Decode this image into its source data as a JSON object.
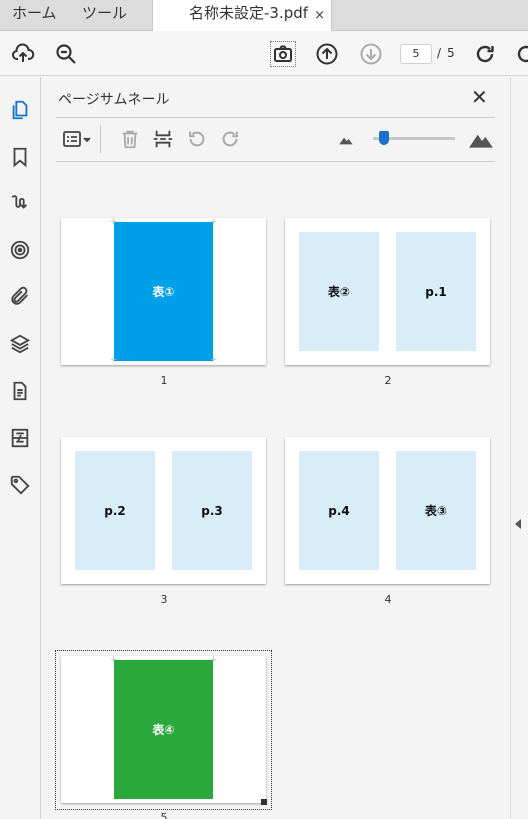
{
  "tabs": {
    "home": "ホーム",
    "tools": "ツール",
    "document": "名称未設定-3.pdf",
    "close_glyph": "×"
  },
  "toolbar": {
    "current_page": "5",
    "separator": "/",
    "total_pages": "5"
  },
  "panel": {
    "title": "ページサムネール",
    "close_glyph": "✕"
  },
  "thumbnails": [
    {
      "number": "1",
      "blocks": [
        "表①"
      ]
    },
    {
      "number": "2",
      "blocks": [
        "表②",
        "p.1"
      ]
    },
    {
      "number": "3",
      "blocks": [
        "p.2",
        "p.3"
      ]
    },
    {
      "number": "4",
      "blocks": [
        "p.4",
        "表③"
      ]
    },
    {
      "number": "5",
      "blocks": [
        "表④"
      ]
    }
  ],
  "colors": {
    "accent": "#1a73c8",
    "block_blue": "#00a0e9",
    "block_green": "#2aa83c",
    "block_light": "#d9edf9"
  },
  "icons": {
    "toolbar": [
      "upload-cloud-icon",
      "zoom-search-icon",
      "snapshot-camera-icon",
      "page-up-icon",
      "page-down-icon",
      "rotate-icon"
    ],
    "rail": [
      "page-thumbnails-icon",
      "bookmark-icon",
      "signature-icon",
      "target-icon",
      "paperclip-icon",
      "layers-icon",
      "document-icon",
      "compare-icon",
      "tag-icon"
    ],
    "panel": [
      "options-list-icon",
      "trash-icon",
      "extract-pages-icon",
      "rotate-ccw-icon",
      "rotate-cw-icon",
      "small-mountain-icon",
      "large-mountain-icon"
    ]
  },
  "zoom_slider_level": 0.07
}
